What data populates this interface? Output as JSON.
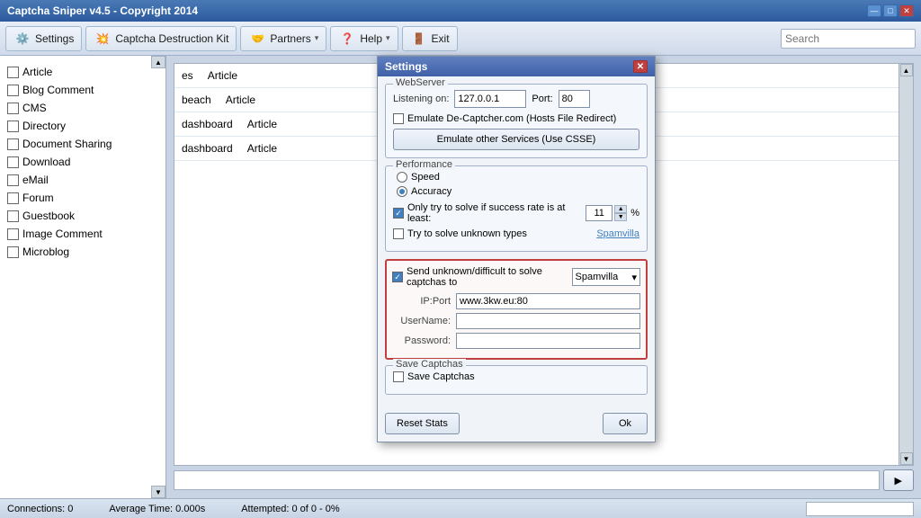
{
  "app": {
    "title": "Captcha Sniper v4.5 - Copyright 2014",
    "title_controls": {
      "minimize": "—",
      "maximize": "□",
      "close": "✕"
    }
  },
  "menu": {
    "settings_label": "Settings",
    "captcha_kit_label": "Captcha Destruction Kit",
    "partners_label": "Partners",
    "partners_arrow": "▾",
    "help_label": "Help",
    "help_arrow": "▾",
    "exit_label": "Exit",
    "search_placeholder": "Search"
  },
  "sidebar": {
    "scroll_up": "▲",
    "scroll_down": "▼",
    "items": [
      {
        "label": "Article",
        "checked": false
      },
      {
        "label": "Blog Comment",
        "checked": false
      },
      {
        "label": "CMS",
        "checked": false
      },
      {
        "label": "Directory",
        "checked": false
      },
      {
        "label": "Document Sharing",
        "checked": false
      },
      {
        "label": "Download",
        "checked": false
      },
      {
        "label": "eMail",
        "checked": false
      },
      {
        "label": "Forum",
        "checked": false
      },
      {
        "label": "Guestbook",
        "checked": false
      },
      {
        "label": "Image Comment",
        "checked": false
      },
      {
        "label": "Microblog",
        "checked": false
      }
    ]
  },
  "content_rows": [
    {
      "col1": "es",
      "col2": "Article"
    },
    {
      "col1": "beach",
      "col2": "Article"
    },
    {
      "col1": "dashboard",
      "col2": "Article"
    },
    {
      "col1": "dashboard",
      "col2": "Article"
    }
  ],
  "status_bar": {
    "connections": "Connections: 0",
    "average_time": "Average Time: 0.000s",
    "attempted": "Attempted: 0 of 0 - 0%"
  },
  "dialog": {
    "title": "Settings",
    "close": "✕",
    "webserver_group": "WebServer",
    "listening_label": "Listening on:",
    "listening_value": "127.0.0.1",
    "port_label": "Port:",
    "port_value": "80",
    "emulate_decaptcher_label": "Emulate De-Captcher.com (Hosts File Redirect)",
    "emulate_other_label": "Emulate other Services (Use CSSE)",
    "performance_group": "Performance",
    "speed_label": "Speed",
    "accuracy_label": "Accuracy",
    "only_try_label": "Only try to solve if success rate is at least:",
    "success_rate_value": "11",
    "success_rate_unit": "%",
    "try_unknown_label": "Try to solve unknown types",
    "spamvilla_link": "Spamvilla",
    "send_unknown_label": "Send unknown/difficult to solve captchas to",
    "send_dropdown": "Spamvilla",
    "ip_port_label": "IP:Port",
    "ip_port_value": "www.3kw.eu:80",
    "username_label": "UserName:",
    "username_value": "",
    "password_label": "Password:",
    "password_value": "",
    "save_captchas_group": "Save Captchas",
    "save_captchas_check": "Save Captchas",
    "reset_stats_label": "Reset Stats",
    "ok_label": "Ok"
  }
}
